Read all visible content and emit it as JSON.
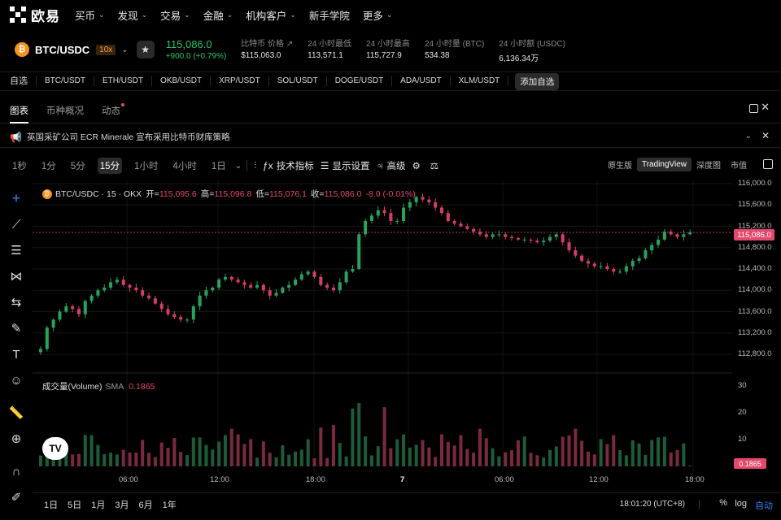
{
  "nav": {
    "logo_text": "欧易",
    "items": [
      "买币",
      "发现",
      "交易",
      "金融",
      "机构客户",
      "新手学院",
      "更多"
    ],
    "chevron_items": [
      true,
      true,
      true,
      true,
      true,
      false,
      true
    ]
  },
  "ticker": {
    "pair": "BTC/USDC",
    "leverage": "10x",
    "price": "115,086.0",
    "change": "+900.0 (+0.79%)",
    "stats": [
      {
        "label": "比特币 价格 ↗",
        "value": "$115,063.0"
      },
      {
        "label": "24 小时最低",
        "value": "113,571.1"
      },
      {
        "label": "24 小时最高",
        "value": "115,727.9"
      },
      {
        "label": "24 小时量 (BTC)",
        "value": "534.38"
      },
      {
        "label": "24 小时额 (USDC)",
        "value": "6,136.34万"
      }
    ]
  },
  "favorites": {
    "label": "自选",
    "items": [
      "BTC/USDT",
      "ETH/USDT",
      "OKB/USDT",
      "XRP/USDT",
      "SOL/USDT",
      "DOGE/USDT",
      "ADA/USDT",
      "XLM/USDT"
    ],
    "add": "添加自选"
  },
  "tabs": [
    "图表",
    "币种概况",
    "动态"
  ],
  "news": "英国采矿公司 ECR Minerale 宣布采用比特币财库策略",
  "toolbar": {
    "intervals": [
      "1秒",
      "1分",
      "5分",
      "15分",
      "1小时",
      "4小时",
      "1日"
    ],
    "active_interval": "15分",
    "buttons": [
      "技术指标",
      "显示设置",
      "高级"
    ],
    "views": [
      "原生版",
      "TradingView",
      "深度图",
      "市值"
    ],
    "active_view": "TradingView"
  },
  "legend": {
    "symbol": "BTC/USDC · 15 · OKX",
    "open_label": "开=",
    "open": "115,095.6",
    "high_label": "高=",
    "high": "115,096.8",
    "low_label": "低=",
    "low": "115,076.1",
    "close_label": "收=",
    "close": "115,086.0",
    "change": "-8.0 (-0.01%)"
  },
  "volume_legend": {
    "label": "成交量(Volume)",
    "sma": "SMA",
    "value": "0.1865"
  },
  "tv_logo": "TV",
  "chart_data": {
    "type": "candlestick",
    "price_ticks": [
      "116,000.0",
      "115,600.0",
      "115,200.0",
      "114,800.0",
      "114,400.0",
      "114,000.0",
      "113,600.0",
      "113,200.0",
      "112,800.0"
    ],
    "price_tick_values": [
      116000,
      115600,
      115200,
      114800,
      114400,
      114000,
      113600,
      113200,
      112800
    ],
    "current_price": "115,086.0",
    "current_price_value": 115086,
    "volume_ticks": [
      "30",
      "20",
      "10"
    ],
    "volume_tick_values": [
      30,
      20,
      10
    ],
    "current_volume": "0.1865",
    "time_ticks": [
      "06:00",
      "12:00",
      "18:00",
      "7",
      "06:00",
      "12:00",
      "18:00"
    ],
    "close_path": [
      112900,
      113300,
      113450,
      113600,
      113700,
      113650,
      113550,
      113800,
      113900,
      114000,
      114050,
      114150,
      114200,
      114100,
      114050,
      114000,
      113900,
      113850,
      113750,
      113650,
      113550,
      113500,
      113450,
      113450,
      113700,
      113900,
      114000,
      114050,
      114200,
      114250,
      114200,
      114150,
      114100,
      114050,
      114100,
      114000,
      113900,
      113950,
      114050,
      114100,
      114200,
      114300,
      114350,
      114250,
      114100,
      114050,
      114000,
      114150,
      114350,
      114400,
      115050,
      115300,
      115400,
      115500,
      115450,
      115300,
      115300,
      115550,
      115650,
      115750,
      115700,
      115650,
      115550,
      115450,
      115300,
      115250,
      115200,
      115150,
      115100,
      115050,
      115000,
      115050,
      115050,
      115000,
      114980,
      114950,
      114950,
      114930,
      114900,
      114930,
      115000,
      115050,
      114900,
      114750,
      114650,
      114550,
      114500,
      114450,
      114450,
      114400,
      114350,
      114350,
      114450,
      114550,
      114600,
      114750,
      114850,
      114950,
      115100,
      115050,
      115000,
      115050,
      115086
    ]
  },
  "bottom": {
    "ranges": [
      "1日",
      "5日",
      "1月",
      "3月",
      "6月",
      "1年"
    ],
    "clock": "18:01:20 (UTC+8)",
    "pct": "%",
    "log": "log",
    "auto": "自动"
  }
}
